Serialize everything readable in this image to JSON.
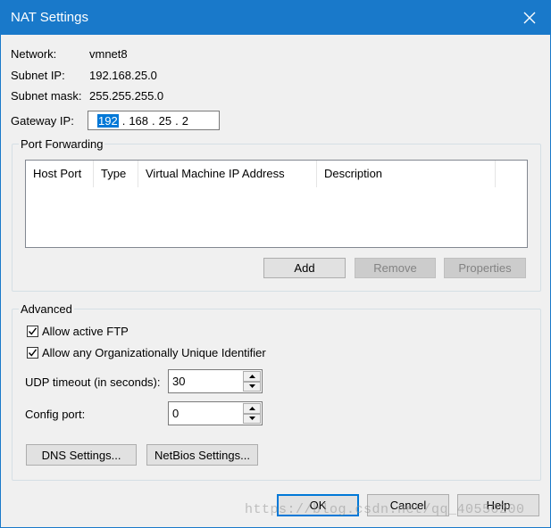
{
  "window": {
    "title": "NAT Settings"
  },
  "info": {
    "network_label": "Network:",
    "network_value": "vmnet8",
    "subnet_ip_label": "Subnet IP:",
    "subnet_ip_value": "192.168.25.0",
    "subnet_mask_label": "Subnet mask:",
    "subnet_mask_value": "255.255.255.0",
    "gateway_label": "Gateway IP:",
    "gateway_octets": [
      "192",
      "168",
      "25",
      "2"
    ],
    "gateway_dot": "."
  },
  "port_forwarding": {
    "legend": "Port Forwarding",
    "columns": [
      "Host Port",
      "Type",
      "Virtual Machine IP Address",
      "Description"
    ],
    "rows": [],
    "add_label": "Add",
    "remove_label": "Remove",
    "properties_label": "Properties"
  },
  "advanced": {
    "legend": "Advanced",
    "active_ftp_label": "Allow active FTP",
    "active_ftp_checked": true,
    "oui_label": "Allow any Organizationally Unique Identifier",
    "oui_checked": true,
    "udp_timeout_label": "UDP timeout (in seconds):",
    "udp_timeout_value": "30",
    "config_port_label": "Config port:",
    "config_port_value": "0",
    "dns_label": "DNS Settings...",
    "netbios_label": "NetBios Settings..."
  },
  "footer": {
    "ok_label": "OK",
    "cancel_label": "Cancel",
    "help_label": "Help"
  },
  "watermark": "https://blog.csdn.net/qq_40550200",
  "colors": {
    "titlebar": "#1979ca",
    "selection": "#0078d7",
    "dialog_bg": "#f0f0f0"
  },
  "icons": {
    "close": "close-icon",
    "check": "checkmark-icon",
    "spin_up": "arrow-up-icon",
    "spin_down": "arrow-down-icon"
  }
}
